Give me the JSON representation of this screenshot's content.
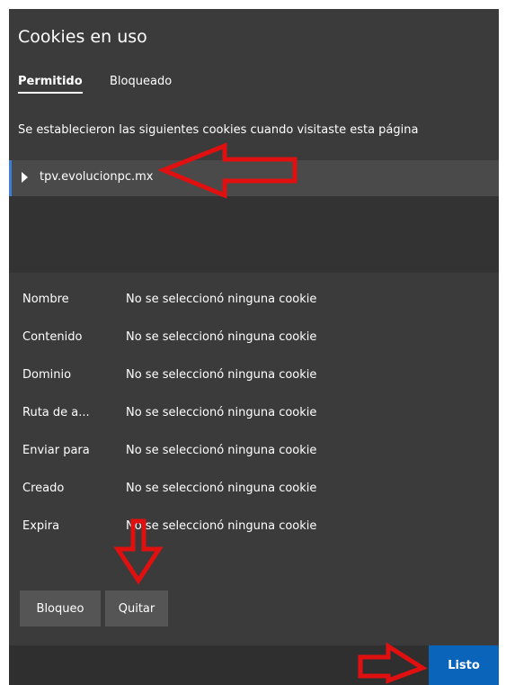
{
  "dialog": {
    "title": "Cookies en uso",
    "tabs": [
      {
        "label": "Permitido",
        "active": true
      },
      {
        "label": "Bloqueado",
        "active": false
      }
    ],
    "description": "Se establecieron las siguientes cookies cuando visitaste esta página",
    "cookie_list": [
      {
        "domain": "tpv.evolucionpc.mx",
        "selected": true
      }
    ],
    "details": [
      {
        "label": "Nombre",
        "value": "No se seleccionó ninguna cookie"
      },
      {
        "label": "Contenido",
        "value": "No se seleccionó ninguna cookie"
      },
      {
        "label": "Dominio",
        "value": "No se seleccionó ninguna cookie"
      },
      {
        "label": "Ruta de a...",
        "value": "No se seleccionó ninguna cookie"
      },
      {
        "label": "Enviar para",
        "value": "No se seleccionó ninguna cookie"
      },
      {
        "label": "Creado",
        "value": "No se seleccionó ninguna cookie"
      },
      {
        "label": "Expira",
        "value": "No se seleccionó ninguna cookie"
      }
    ],
    "buttons": {
      "block": "Bloqueo",
      "remove": "Quitar",
      "done": "Listo"
    }
  },
  "colors": {
    "dialog_bg": "#3b3b3b",
    "selected_row_bg": "#4a4a4a",
    "accent": "#3a7fd0",
    "button_bg": "#555555",
    "primary_button_bg": "#0a64ba",
    "annotation_arrow": "#e01010"
  },
  "annotations": [
    {
      "icon": "red-arrow-left-icon",
      "points_to": "cookie-row"
    },
    {
      "icon": "red-arrow-down-icon",
      "points_to": "remove-button"
    },
    {
      "icon": "red-arrow-right-icon",
      "points_to": "done-button"
    }
  ]
}
